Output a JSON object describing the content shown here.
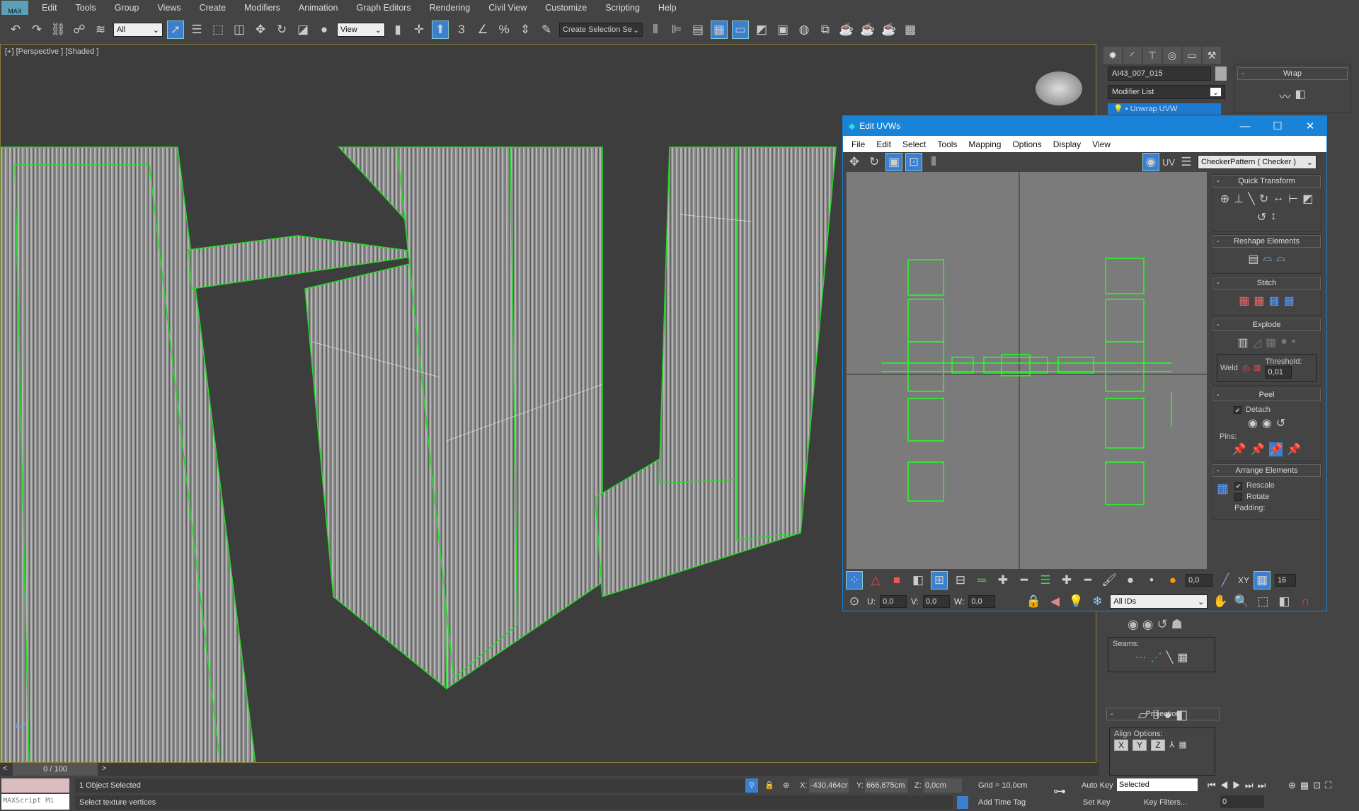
{
  "app": {
    "logo": "MAX"
  },
  "menubar": [
    "Edit",
    "Tools",
    "Group",
    "Views",
    "Create",
    "Modifiers",
    "Animation",
    "Graph Editors",
    "Rendering",
    "Civil View",
    "Customize",
    "Scripting",
    "Help"
  ],
  "toolbar": {
    "filter": "All",
    "ref_coord": "View",
    "selection_set_placeholder": "Create Selection Se",
    "snap_angle": "3",
    "icons": [
      "undo-icon",
      "redo-icon",
      "link-icon",
      "unlink-icon",
      "bind-space-warp-icon",
      "select-object-icon",
      "select-by-name-icon",
      "rect-selection-icon",
      "window-crossing-icon",
      "move-icon",
      "rotate-icon",
      "scale-icon",
      "pivot-icon",
      "mirror-icon",
      "align-icon",
      "snap-icon",
      "angle-snap-icon",
      "percent-snap-icon",
      "spinner-snap-icon",
      "edit-named-sets-icon"
    ]
  },
  "viewport": {
    "label": "[+] [Perspective ] [Shaded ]"
  },
  "command_panel": {
    "object_name": "AI43_007_015",
    "modifier_list": "Modifier List",
    "stack_item": "Unwrap UVW",
    "wrap_title": "Wrap",
    "seams_label": "Seams:",
    "projection_title": "Projection",
    "align_options": "Align Options:",
    "align_buttons": [
      "X",
      "Y",
      "Z"
    ]
  },
  "uvw": {
    "title": "Edit UVWs",
    "menu": [
      "File",
      "Edit",
      "Select",
      "Tools",
      "Mapping",
      "Options",
      "Display",
      "View"
    ],
    "uv_label": "UV",
    "texture": "CheckerPattern  ( Checker )",
    "panel": {
      "quick_transform": "Quick Transform",
      "reshape": "Reshape Elements",
      "stitch": "Stitch",
      "explode": "Explode",
      "weld": "Weld",
      "threshold_label": "Threshold:",
      "threshold": "0,01",
      "peel": "Peel",
      "detach": "Detach",
      "detach_checked": true,
      "pins": "Pins:",
      "arrange": "Arrange Elements",
      "rescale": "Rescale",
      "rescale_checked": true,
      "rotate": "Rotate",
      "rotate_checked": false,
      "padding": "Padding:"
    },
    "bottom": {
      "soft_value": "0,0",
      "xy_label": "XY",
      "grid_value": "16",
      "u_label": "U:",
      "u": "0,0",
      "v_label": "V:",
      "v": "0,0",
      "w_label": "W:",
      "w": "0,0",
      "ids": "All IDs"
    }
  },
  "timeline": {
    "frame": "0 / 100"
  },
  "status": {
    "maxscript": "MAXScript Mi",
    "selected": "1 Object Selected",
    "prompt": "Select texture vertices",
    "x_label": "X:",
    "x": "-430,464cr",
    "y_label": "Y:",
    "y": "666,875cm",
    "z_label": "Z:",
    "z": "0,0cm",
    "grid": "Grid = 10,0cm",
    "add_time_tag": "Add Time Tag",
    "auto_key": "Auto Key",
    "set_key": "Set Key",
    "key_mode": "Selected",
    "key_filters": "Key Filters...",
    "current_frame": "0"
  },
  "colors": {
    "accent": "#1883d7",
    "wire": "#22dd22",
    "viewport_bg": "#3d3d3d",
    "uv_bg": "#7b7b7b"
  }
}
